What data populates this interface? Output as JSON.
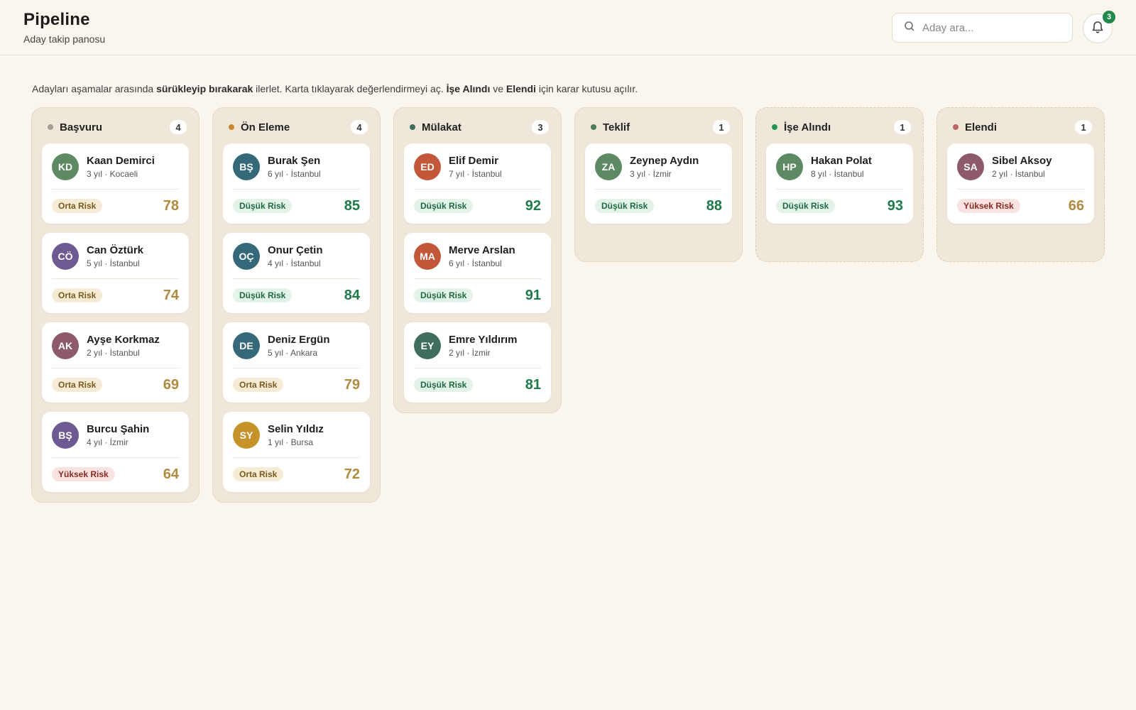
{
  "header": {
    "title": "Pipeline",
    "subtitle": "Aday takip panosu",
    "search_placeholder": "Aday ara...",
    "notification_count": "3"
  },
  "instructions": {
    "part1": "Adayları aşamalar arasında ",
    "bold1": "sürükleyip bırakarak",
    "part2": " ilerlet. Karta tıklayarak değerlendirmeyi aç. ",
    "bold2": "İşe Alındı",
    "part3": " ve ",
    "bold3": "Elendi",
    "part4": " için karar kutusu açılır."
  },
  "columns": [
    {
      "title": "Başvuru",
      "count": "4",
      "dot_color": "#a39e96",
      "dashed": false,
      "cards": [
        {
          "initials": "KD",
          "name": "Kaan Demirci",
          "meta": "3 yıl · Kocaeli",
          "risk": "Orta Risk",
          "risk_level": "mid",
          "score": "78",
          "avatar_color": "#5e8a63"
        },
        {
          "initials": "CÖ",
          "name": "Can Öztürk",
          "meta": "5 yıl · İstanbul",
          "risk": "Orta Risk",
          "risk_level": "mid",
          "score": "74",
          "avatar_color": "#6d5a93"
        },
        {
          "initials": "AK",
          "name": "Ayşe Korkmaz",
          "meta": "2 yıl · İstanbul",
          "risk": "Orta Risk",
          "risk_level": "mid",
          "score": "69",
          "avatar_color": "#8d5a6c"
        },
        {
          "initials": "BŞ",
          "name": "Burcu Şahin",
          "meta": "4 yıl · İzmir",
          "risk": "Yüksek Risk",
          "risk_level": "high",
          "score": "64",
          "avatar_color": "#6d5a93"
        }
      ]
    },
    {
      "title": "Ön Eleme",
      "count": "4",
      "dot_color": "#c9882d",
      "dashed": false,
      "cards": [
        {
          "initials": "BŞ",
          "name": "Burak Şen",
          "meta": "6 yıl · İstanbul",
          "risk": "Düşük Risk",
          "risk_level": "low",
          "score": "85",
          "avatar_color": "#35697a"
        },
        {
          "initials": "OÇ",
          "name": "Onur Çetin",
          "meta": "4 yıl · İstanbul",
          "risk": "Düşük Risk",
          "risk_level": "low",
          "score": "84",
          "avatar_color": "#35697a"
        },
        {
          "initials": "DE",
          "name": "Deniz Ergün",
          "meta": "5 yıl · Ankara",
          "risk": "Orta Risk",
          "risk_level": "mid",
          "score": "79",
          "avatar_color": "#35697a"
        },
        {
          "initials": "SY",
          "name": "Selin Yıldız",
          "meta": "1 yıl · Bursa",
          "risk": "Orta Risk",
          "risk_level": "mid",
          "score": "72",
          "avatar_color": "#c6922a"
        }
      ]
    },
    {
      "title": "Mülakat",
      "count": "3",
      "dot_color": "#3f6e5d",
      "dashed": false,
      "cards": [
        {
          "initials": "ED",
          "name": "Elif Demir",
          "meta": "7 yıl · İstanbul",
          "risk": "Düşük Risk",
          "risk_level": "low",
          "score": "92",
          "avatar_color": "#c2573a"
        },
        {
          "initials": "MA",
          "name": "Merve Arslan",
          "meta": "6 yıl · İstanbul",
          "risk": "Düşük Risk",
          "risk_level": "low",
          "score": "91",
          "avatar_color": "#c2573a"
        },
        {
          "initials": "EY",
          "name": "Emre Yıldırım",
          "meta": "2 yıl · İzmir",
          "risk": "Düşük Risk",
          "risk_level": "low",
          "score": "81",
          "avatar_color": "#3f6e5d"
        }
      ]
    },
    {
      "title": "Teklif",
      "count": "1",
      "dot_color": "#4d7a5a",
      "dashed": false,
      "cards": [
        {
          "initials": "ZA",
          "name": "Zeynep Aydın",
          "meta": "3 yıl · İzmir",
          "risk": "Düşük Risk",
          "risk_level": "low",
          "score": "88",
          "avatar_color": "#5e8a63"
        }
      ]
    },
    {
      "title": "İşe Alındı",
      "count": "1",
      "dot_color": "#1f9a55",
      "dashed": true,
      "cards": [
        {
          "initials": "HP",
          "name": "Hakan Polat",
          "meta": "8 yıl · İstanbul",
          "risk": "Düşük Risk",
          "risk_level": "low",
          "score": "93",
          "avatar_color": "#5e8a63"
        }
      ]
    },
    {
      "title": "Elendi",
      "count": "1",
      "dot_color": "#c0645e",
      "dashed": true,
      "cards": [
        {
          "initials": "SA",
          "name": "Sibel Aksoy",
          "meta": "2 yıl · İstanbul",
          "risk": "Yüksek Risk",
          "risk_level": "high",
          "score": "66",
          "avatar_color": "#8d5a6c"
        }
      ]
    }
  ]
}
